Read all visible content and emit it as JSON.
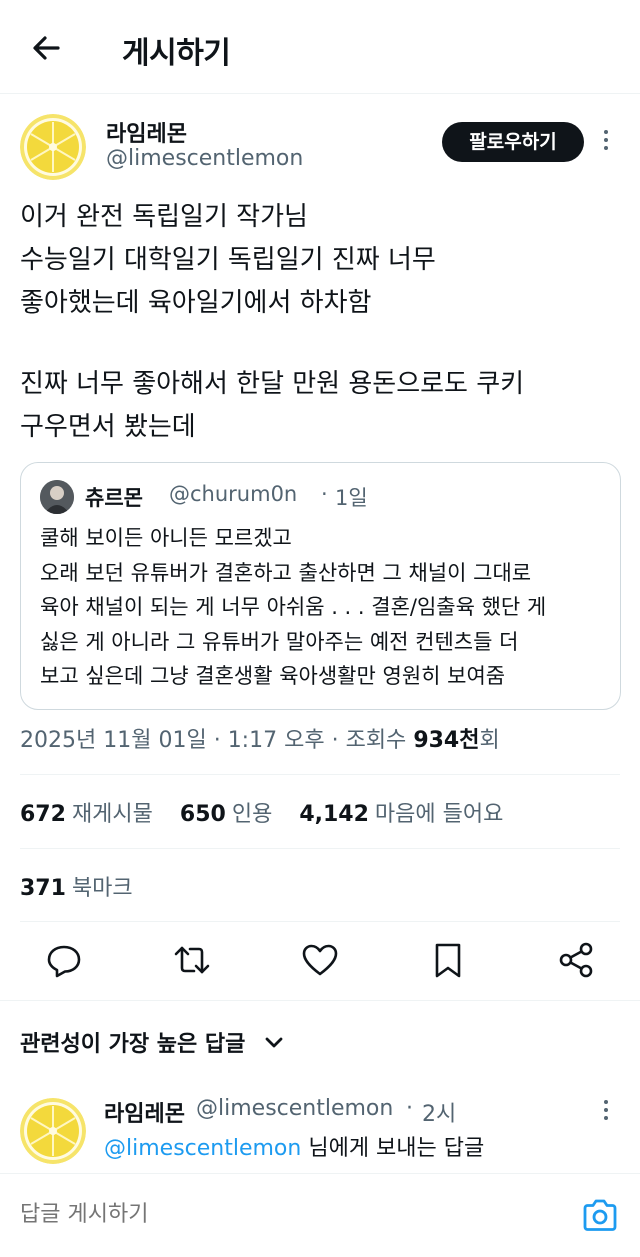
{
  "header": {
    "title": "게시하기",
    "back_icon": "arrow-left-icon"
  },
  "tweet": {
    "author_name": "라임레몬",
    "author_handle": "@limescentlemon",
    "follow_label": "팔로우하기",
    "text_lines_1": [
      "이거 완전 독립일기 작가님",
      "수능일기 대학일기 독립일기 진짜 너무",
      "좋아했는데 육아일기에서 하차함"
    ],
    "text_lines_2": [
      "진짜 너무 좋아해서 한달 만원 용돈으로도 쿠키",
      "구우면서 봤는데"
    ],
    "date": "2025년 11월 01일",
    "time": "1:17 오후",
    "views_label": "조회수",
    "views_count": "934천",
    "views_suffix": "회"
  },
  "quote": {
    "name": "츄르몬",
    "handle": "@churum0n",
    "separator": "·",
    "time": "1일",
    "lines": [
      "쿨해 보이든 아니든 모르겠고",
      "오래 보던 유튜버가 결혼하고 출산하면 그 채널이 그대로",
      "육아 채널이 되는 게 너무 아쉬움 . . . 결혼/임출육 했단 게",
      "싫은 게 아니라 그 유튜버가 말아주는 예전 컨텐츠들 더",
      "보고 싶은데 그냥 결혼생활 육아생활만 영원히 보여줌"
    ]
  },
  "meta_separator": "·",
  "stats": {
    "reposts_count": "672",
    "reposts_label": "재게시물",
    "quotes_count": "650",
    "quotes_label": "인용",
    "likes_count": "4,142",
    "likes_label": "마음에 들어요",
    "bookmarks_count": "371",
    "bookmarks_label": "북마크"
  },
  "actions": [
    "reply-icon",
    "repost-icon",
    "like-icon",
    "bookmark-icon",
    "share-icon"
  ],
  "replies": {
    "sort_label": "관련성이 가장 높은 답글",
    "items": [
      {
        "name": "라임레몬",
        "handle": "@limescentlemon",
        "separator": "·",
        "time": "2시",
        "mention": "@limescentlemon",
        "text": " 님에게 보내는 답글"
      }
    ]
  },
  "composer": {
    "placeholder": "답글 게시하기",
    "camera_icon": "camera-icon"
  },
  "colors": {
    "accent": "#1d9bf0",
    "text": "#0f1419",
    "muted": "#536471",
    "border": "#cfd9de"
  }
}
